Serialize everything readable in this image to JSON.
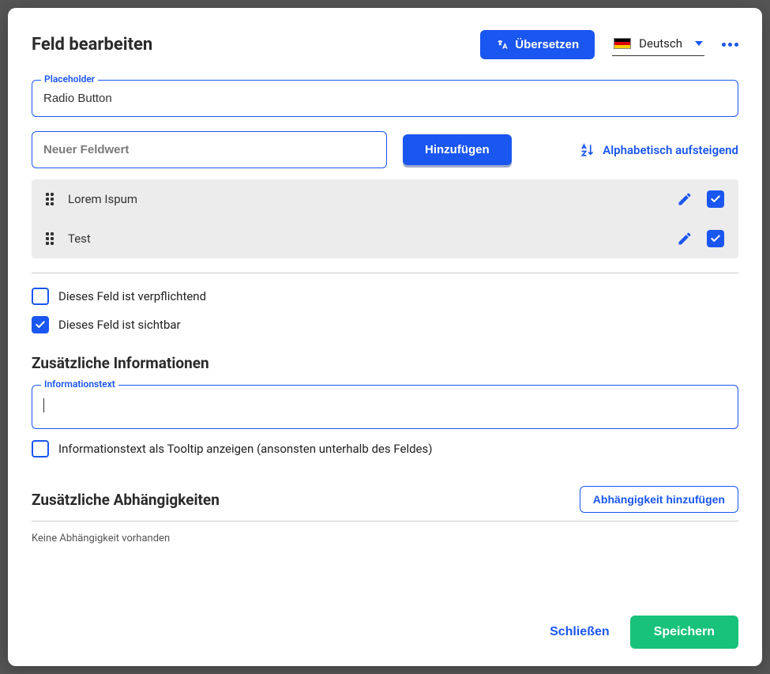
{
  "header": {
    "title": "Feld bearbeiten",
    "translate_label": "Übersetzen",
    "language": "Deutsch"
  },
  "placeholder_field": {
    "label": "Placeholder",
    "value": "Radio Button"
  },
  "new_value": {
    "placeholder": "Neuer Feldwert",
    "add_label": "Hinzufügen",
    "sort_label": "Alphabetisch aufsteigend"
  },
  "items": [
    {
      "label": "Lorem Ispum",
      "checked": true
    },
    {
      "label": "Test",
      "checked": true
    }
  ],
  "required": {
    "label": "Dieses Feld ist verpflichtend",
    "checked": false
  },
  "visible": {
    "label": "Dieses Feld ist sichtbar",
    "checked": true
  },
  "info_section": {
    "title": "Zusätzliche Informationen",
    "text_label": "Informationstext",
    "text_value": "",
    "tooltip_label": "Informationstext als Tooltip anzeigen (ansonsten unterhalb des Feldes)",
    "tooltip_checked": false
  },
  "dep_section": {
    "title": "Zusätzliche Abhängigkeiten",
    "add_label": "Abhängigkeit hinzufügen",
    "empty": "Keine Abhängigkeit vorhanden"
  },
  "footer": {
    "close": "Schließen",
    "save": "Speichern"
  }
}
